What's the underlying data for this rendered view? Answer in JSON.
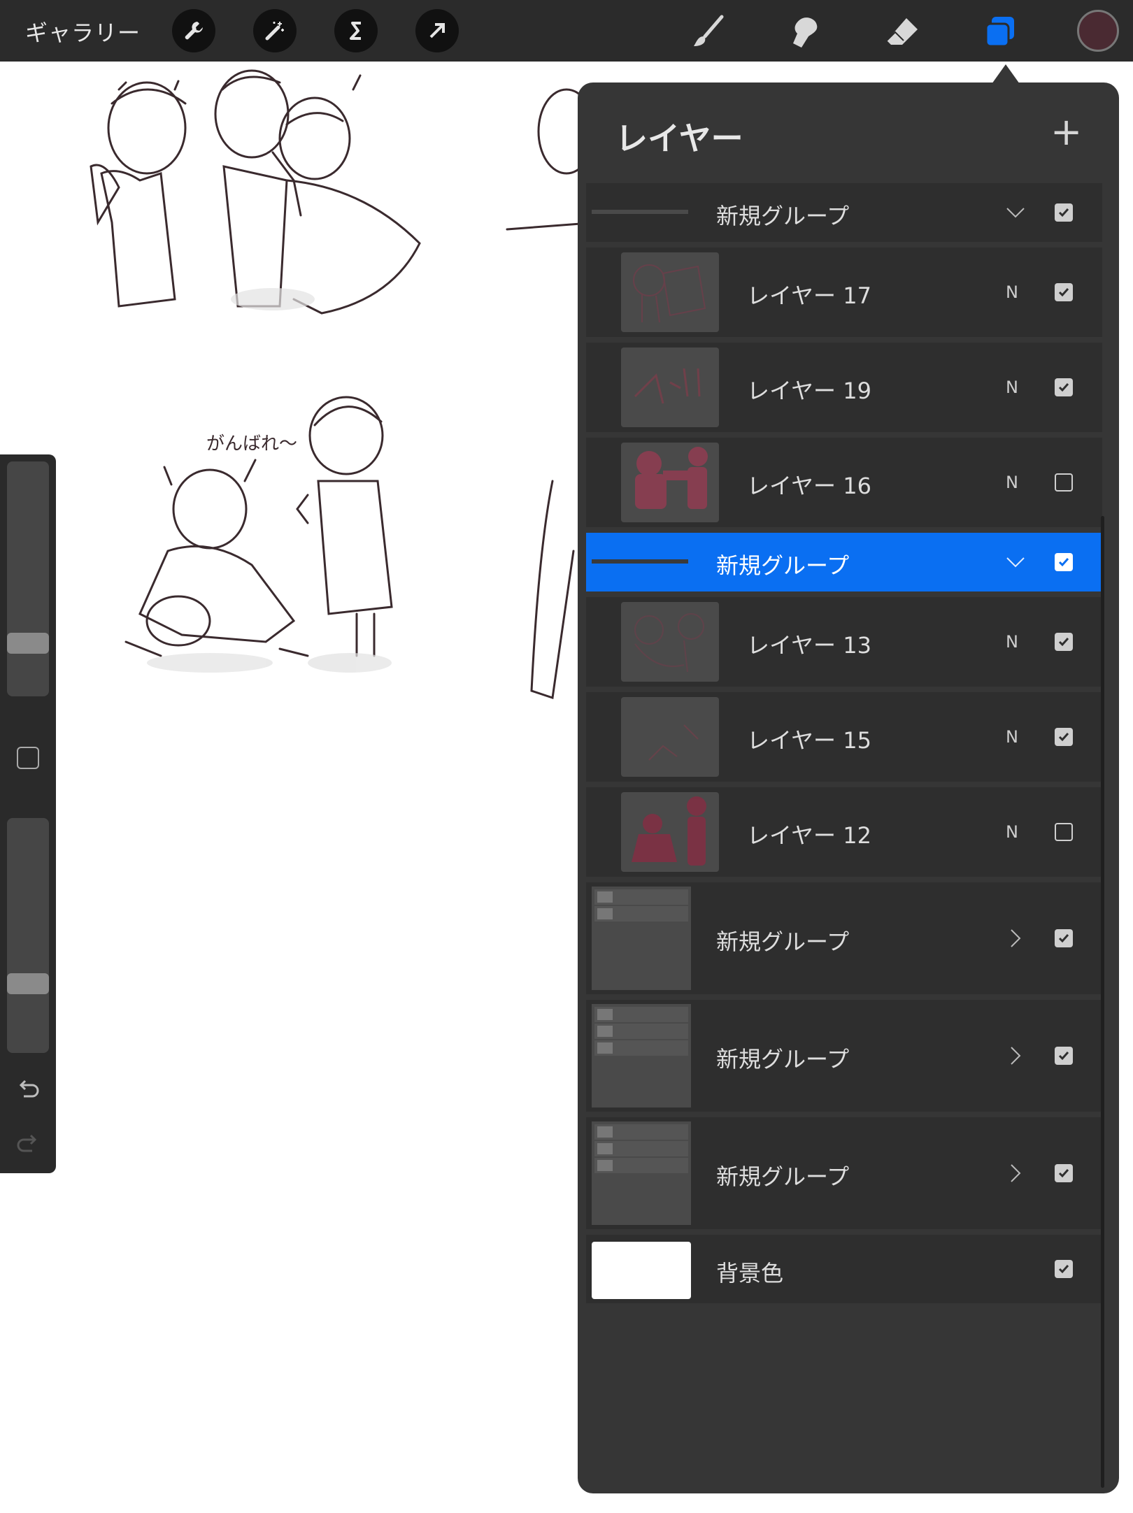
{
  "topbar": {
    "gallery_label": "ギャラリー",
    "left_tools": [
      "wrench-icon",
      "magic-wand-icon",
      "selection-s-icon",
      "transform-arrow-icon"
    ],
    "right_tools": [
      "brush-icon",
      "smudge-icon",
      "eraser-icon",
      "layers-icon"
    ],
    "active_tool": "layers-icon",
    "accent_color": "#0a6ff2",
    "current_color": "#4a2a32"
  },
  "layers_panel": {
    "title": "レイヤー",
    "add_button": "+",
    "layers": [
      {
        "type": "group",
        "name": "新規グループ",
        "expanded": true,
        "visible": true,
        "selected": false
      },
      {
        "type": "layer",
        "name": "レイヤー 17",
        "blend": "N",
        "visible": true
      },
      {
        "type": "layer",
        "name": "レイヤー 19",
        "blend": "N",
        "visible": true
      },
      {
        "type": "layer",
        "name": "レイヤー 16",
        "blend": "N",
        "visible": false
      },
      {
        "type": "group",
        "name": "新規グループ",
        "expanded": true,
        "visible": true,
        "selected": true
      },
      {
        "type": "layer",
        "name": "レイヤー 13",
        "blend": "N",
        "visible": true
      },
      {
        "type": "layer",
        "name": "レイヤー 15",
        "blend": "N",
        "visible": true
      },
      {
        "type": "layer",
        "name": "レイヤー 12",
        "blend": "N",
        "visible": false
      },
      {
        "type": "group",
        "name": "新規グループ",
        "expanded": false,
        "visible": true,
        "selected": false
      },
      {
        "type": "group",
        "name": "新規グループ",
        "expanded": false,
        "visible": true,
        "selected": false
      },
      {
        "type": "group",
        "name": "新規グループ",
        "expanded": false,
        "visible": true,
        "selected": false
      },
      {
        "type": "background",
        "name": "背景色",
        "visible": true
      }
    ]
  },
  "canvas": {
    "annotation_text": "がんばれ〜"
  }
}
